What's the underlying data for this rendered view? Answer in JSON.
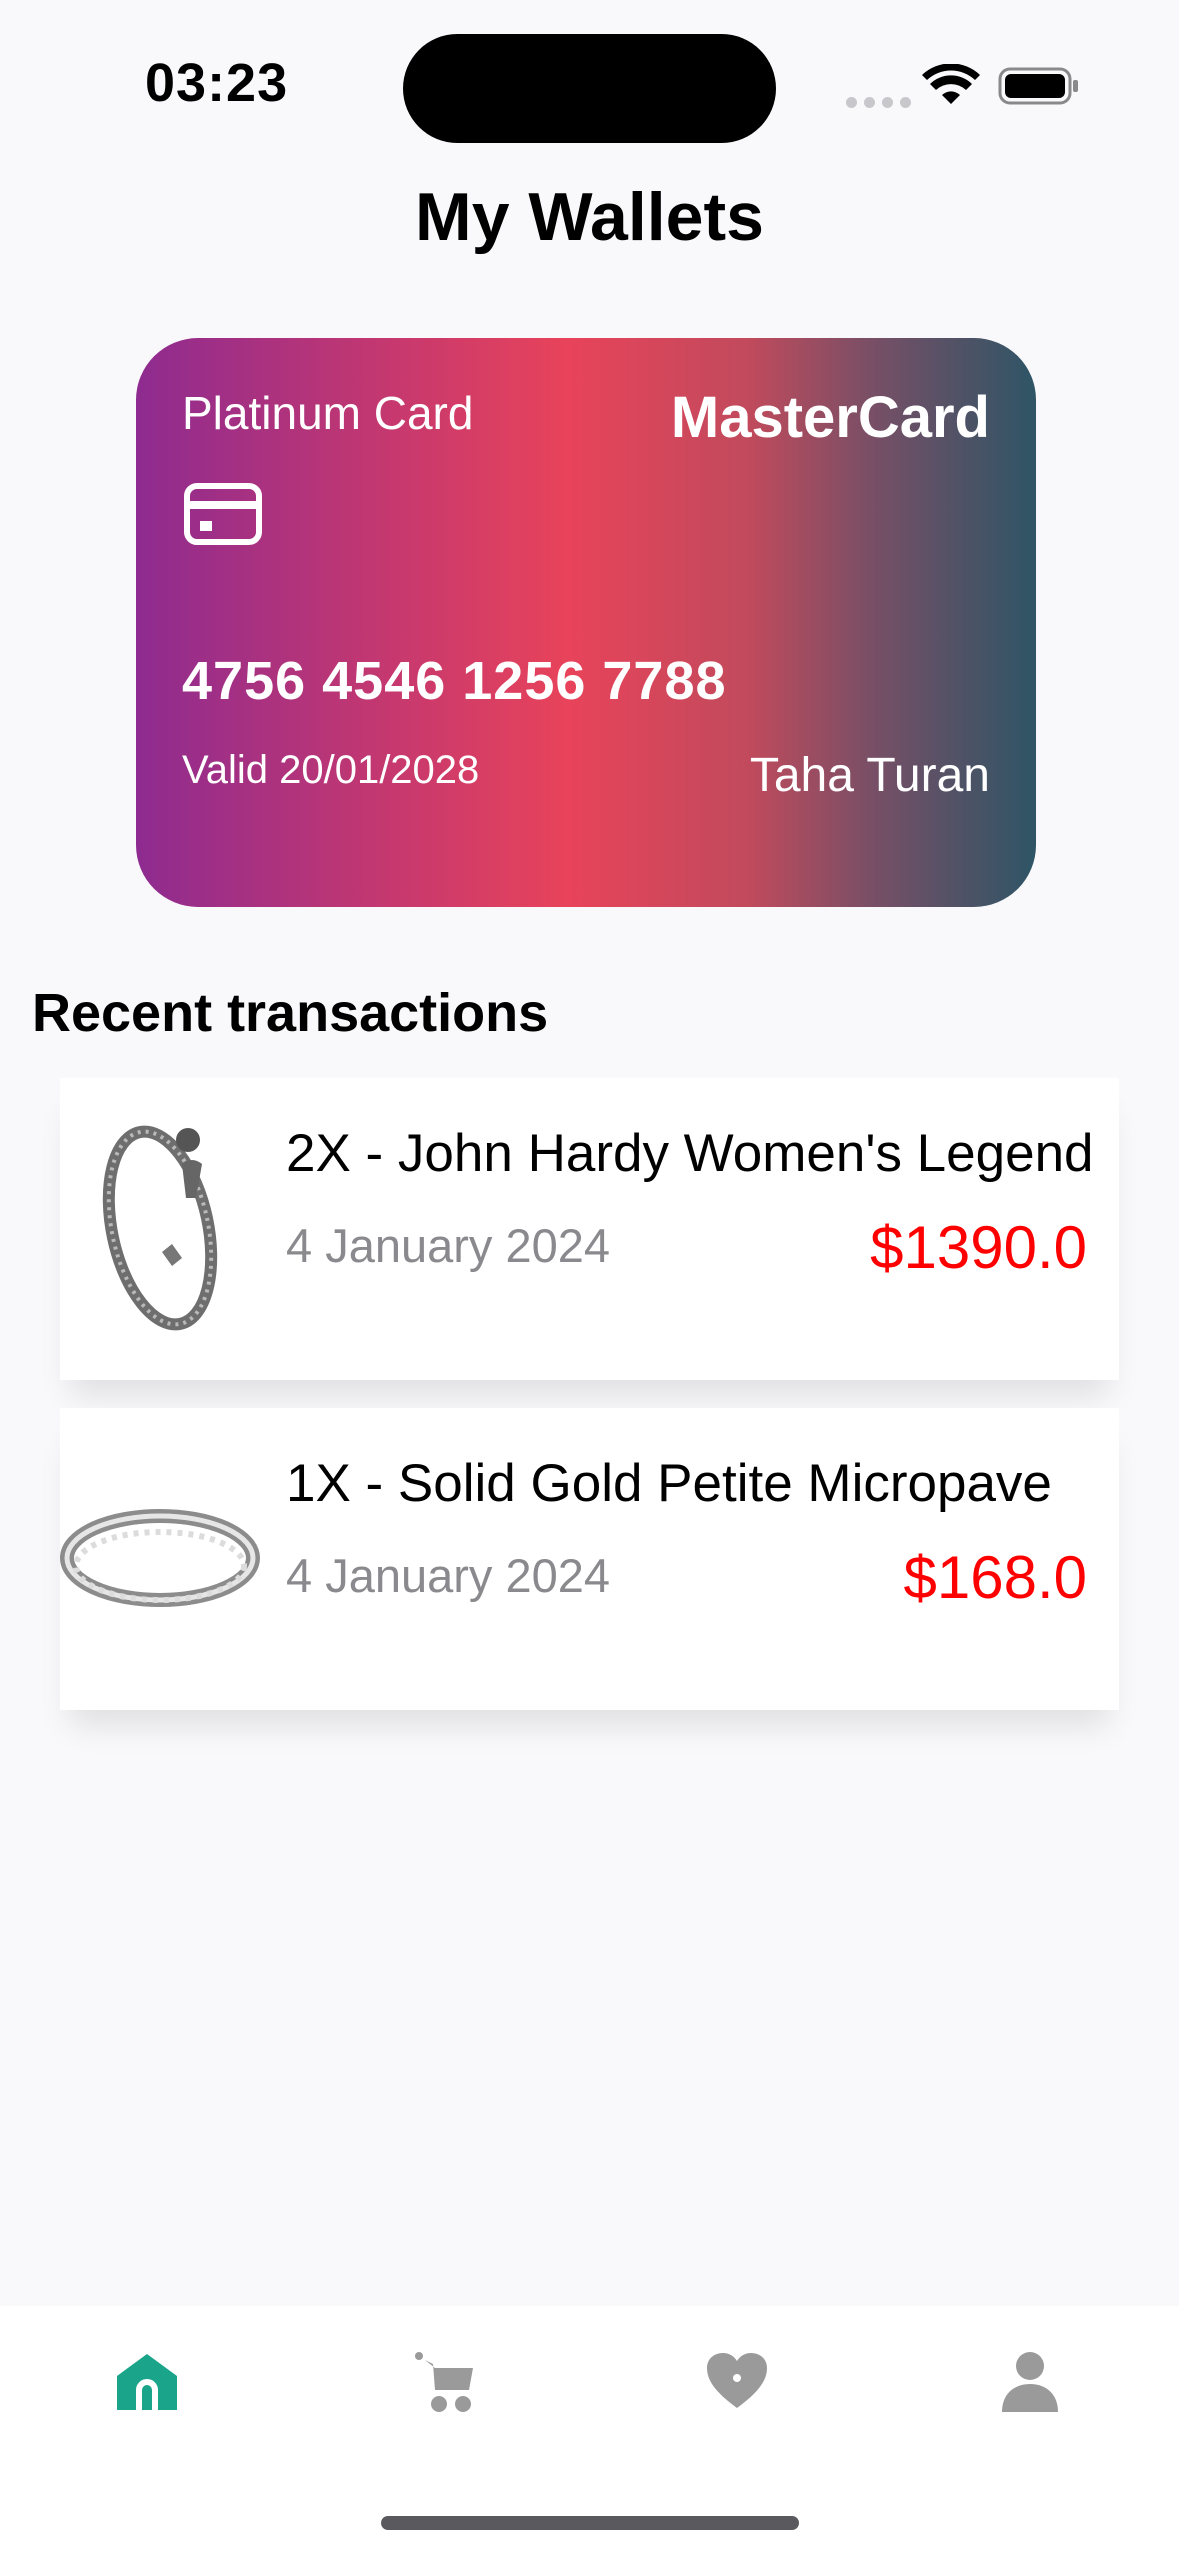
{
  "status_bar": {
    "time": "03:23"
  },
  "header": {
    "title": "My Wallets"
  },
  "card": {
    "type_label": "Platinum Card",
    "brand": "MasterCard",
    "number": "4756 4546 1256 7788",
    "valid": "Valid 20/01/2028",
    "holder": "Taha Turan",
    "gradient_colors": [
      "#8e2b90",
      "#e8435a",
      "#2e5566"
    ]
  },
  "transactions": {
    "title": "Recent transactions",
    "items": [
      {
        "name": "2X - John Hardy Women's Legend",
        "date": "4 January 2024",
        "amount": "$1390.0",
        "thumb_icon": "bracelet-icon"
      },
      {
        "name": "1X - Solid Gold Petite Micropave",
        "date": "4 January 2024",
        "amount": "$168.0",
        "thumb_icon": "ring-icon"
      }
    ]
  },
  "tab_bar": {
    "items": [
      {
        "icon": "home-icon",
        "active": true,
        "color": "#1aa58a"
      },
      {
        "icon": "cart-icon",
        "active": false,
        "color": "#9a9a9a"
      },
      {
        "icon": "heart-icon",
        "active": false,
        "color": "#9a9a9a"
      },
      {
        "icon": "profile-icon",
        "active": false,
        "color": "#9a9a9a"
      }
    ]
  },
  "colors": {
    "amount": "#ff0000",
    "background": "#f9f9fb"
  }
}
